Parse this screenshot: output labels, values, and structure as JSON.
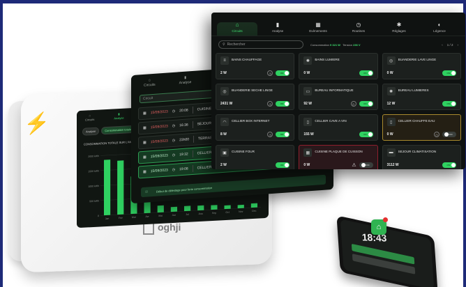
{
  "brand": {
    "logo_text": "oghji"
  },
  "screen3": {
    "tabs": [
      {
        "label": "Circuits",
        "icon": "circuit-icon",
        "glyph": "⌂",
        "active": true
      },
      {
        "label": "Analyse",
        "icon": "chart-icon",
        "glyph": "▮",
        "active": false
      },
      {
        "label": "Evènements",
        "icon": "calendar-icon",
        "glyph": "▦",
        "active": false
      },
      {
        "label": "Routines",
        "icon": "clock-icon",
        "glyph": "◷",
        "active": false
      },
      {
        "label": "Réglages",
        "icon": "gear-icon",
        "glyph": "✱",
        "active": false
      },
      {
        "label": "Légence",
        "icon": "globe-icon",
        "glyph": "◐",
        "active": false
      }
    ],
    "search_placeholder": "Rechercher",
    "consumption_label": "Consommation",
    "consumption_value": "9 321 W",
    "tension_label": "Tension",
    "tension_value": "236 V",
    "pager": "1 / 2",
    "cards": [
      {
        "name": "BAINS CHAUFFAGE",
        "power": "2 W",
        "icon": "heater-icon",
        "glyph": "≡",
        "state": "ON",
        "style": "normal",
        "mode": true
      },
      {
        "name": "BAINS LUMIERE",
        "power": "0 W",
        "icon": "light-icon",
        "glyph": "✺",
        "state": "ON",
        "style": "normal",
        "mode": false
      },
      {
        "name": "BUANDERIE LAVE LINGE",
        "power": "0 W",
        "icon": "washer-icon",
        "glyph": "◎",
        "state": "ON",
        "style": "normal",
        "mode": false
      },
      {
        "name": "BUANDERIE SECHE LINGE",
        "power": "2431 W",
        "icon": "dryer-icon",
        "glyph": "◎",
        "state": "ON",
        "style": "normal",
        "mode": true
      },
      {
        "name": "BUREAU INFORMATIQUE",
        "power": "92 W",
        "icon": "computer-icon",
        "glyph": "▭",
        "state": "ON",
        "style": "normal",
        "mode": true
      },
      {
        "name": "BUREAU LUMIERES",
        "power": "12 W",
        "icon": "light-icon",
        "glyph": "✺",
        "state": "ON",
        "style": "normal",
        "mode": false
      },
      {
        "name": "CELLIER BOX INTERNET",
        "power": "8 W",
        "icon": "wifi-icon",
        "glyph": "◠",
        "state": "ON",
        "style": "normal",
        "mode": true
      },
      {
        "name": "CELLIER CAVE A VIN",
        "power": "155 W",
        "icon": "fridge-icon",
        "glyph": "▯",
        "state": "ON",
        "style": "normal",
        "mode": false
      },
      {
        "name": "CELLIER CHAUFFE EAU",
        "power": "0 W",
        "icon": "boiler-icon",
        "glyph": "▯",
        "state": "OFF",
        "style": "yellow",
        "mode": true
      },
      {
        "name": "CUISINE FOUR",
        "power": "2 W",
        "icon": "oven-icon",
        "glyph": "▣",
        "state": "ON",
        "style": "normal",
        "mode": false
      },
      {
        "name": "CUISINE PLAQUE DE CUISSON",
        "power": "0 W",
        "icon": "stove-icon",
        "glyph": "▦",
        "state": "OFF",
        "style": "red",
        "mode": false,
        "warning": true
      },
      {
        "name": "SEJOUR CLIMATISATION",
        "power": "3112 W",
        "icon": "ac-icon",
        "glyph": "▬",
        "state": "ON",
        "style": "normal",
        "mode": false
      }
    ]
  },
  "screen2": {
    "tabs": [
      {
        "label": "Circuits",
        "icon": "circuit-icon",
        "glyph": "⌂"
      },
      {
        "label": "Analyse",
        "icon": "chart-icon",
        "glyph": "▮"
      }
    ],
    "search_placeholder": "Circuit",
    "events": [
      {
        "date": "15/09/2023",
        "time": "20:08",
        "circuit": "CUISINE",
        "highlight": false
      },
      {
        "date": "15/09/2023",
        "time": "16:36",
        "circuit": "SEJOUR",
        "highlight": false
      },
      {
        "date": "15/09/2023",
        "time": "23h00",
        "circuit": "TERRASSE",
        "highlight": false
      },
      {
        "date": "15/09/2023",
        "time": "19:32",
        "circuit": "CELLIER",
        "highlight": true
      },
      {
        "date": "15/09/2023",
        "time": "19:08",
        "circuit": "CELLIER CHAUFFE EAU",
        "highlight": true
      }
    ],
    "footer_note": "Début de délestage pour forte consommation"
  },
  "screen1": {
    "tabs": [
      {
        "label": "Circuits",
        "icon": "circuit-icon",
        "glyph": "⌂"
      },
      {
        "label": "Analyse",
        "icon": "chart-icon",
        "glyph": "▮"
      }
    ],
    "pills": [
      {
        "label": "Analyse",
        "active": false
      },
      {
        "label": "Consommation totale",
        "active": true
      }
    ],
    "chart_title": "CONSOMMATION TOTALE SUR L'ANNÉE"
  },
  "chart_data": {
    "type": "bar",
    "categories": [
      "Jan",
      "Fev",
      "Mar",
      "Avr",
      "Mai",
      "Jun",
      "Jul",
      "Aou",
      "Sep",
      "Oct",
      "Nov",
      "Dec"
    ],
    "values": [
      1850,
      1800,
      1250,
      600,
      230,
      160,
      170,
      160,
      150,
      120,
      110,
      140
    ],
    "ylim": [
      0,
      2000
    ],
    "ytick_labels": [
      "0",
      "500 kWh",
      "1000 kWh",
      "1500 kWh",
      "2000 kWh"
    ],
    "bar_color": "#2fd161"
  },
  "phone": {
    "time": "18:43",
    "app_icon": "house-app-icon",
    "notification_badge_color": "#e53030"
  },
  "colors": {
    "accent": "#2fd161",
    "warning_border": "#8f1f2d",
    "alert_border": "#a98a2e",
    "frame": "#1e2a78"
  }
}
